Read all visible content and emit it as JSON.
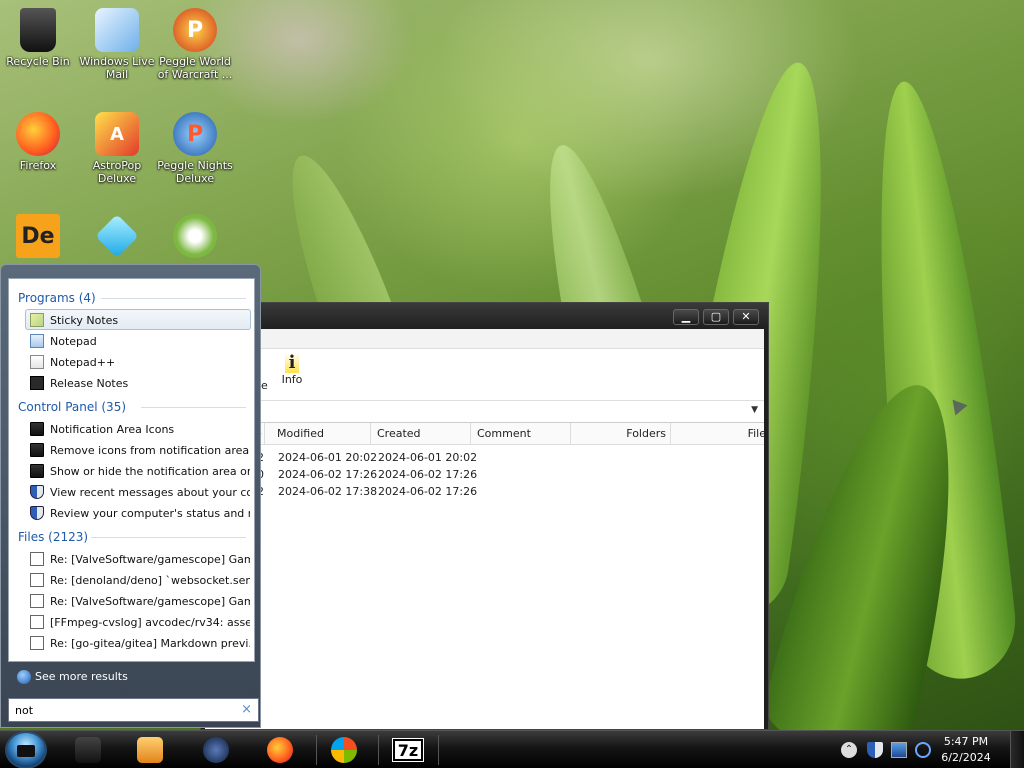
{
  "desktop": {
    "icons": [
      {
        "label": "Recycle Bin"
      },
      {
        "label": "Windows Live Mail"
      },
      {
        "label": "Peggle World of Warcraft ..."
      },
      {
        "label": "Firefox"
      },
      {
        "label": "AstroPop Deluxe"
      },
      {
        "label": "Peggle Nights Deluxe"
      },
      {
        "label": ""
      },
      {
        "label": ""
      },
      {
        "label": ""
      }
    ]
  },
  "window": {
    "toolbar_partial_label": "e",
    "info_label": "Info",
    "minimize": "▁",
    "maximize": "▢",
    "close": "✕",
    "columns": {
      "partial": "e",
      "modified": "Modified",
      "created": "Created",
      "comment": "Comment",
      "folders": "Folders",
      "files": "File"
    },
    "rows": [
      {
        "partial": "2",
        "modified": "2024-06-01 20:02",
        "created": "2024-06-01 20:02"
      },
      {
        "partial": "0",
        "modified": "2024-06-02 17:26",
        "created": "2024-06-02 17:26"
      },
      {
        "partial": "2",
        "modified": "2024-06-02 17:38",
        "created": "2024-06-02 17:26"
      }
    ]
  },
  "start_menu": {
    "programs": {
      "header": "Programs (4)",
      "items": [
        "Sticky Notes",
        "Notepad",
        "Notepad++",
        "Release Notes"
      ]
    },
    "control_panel": {
      "header": "Control Panel (35)",
      "items": [
        "Notification Area Icons",
        "Remove icons from notification area (...",
        "Show or hide the notification area on ...",
        "View recent messages about your co...",
        "Review your computer's status and re..."
      ]
    },
    "files": {
      "header": "Files (2123)",
      "items": [
        "Re: [ValveSoftware/gamescope] Gam...",
        "Re: [denoland/deno] `websocket.send...",
        "Re: [ValveSoftware/gamescope] Gam...",
        "[FFmpeg-cvslog] avcodec/rv34: asser...",
        "Re: [go-gitea/gitea] Markdown previ..."
      ]
    },
    "see_more": "See more results",
    "search_value": "not",
    "clear_glyph": "×"
  },
  "taskbar": {
    "time": "5:47 PM",
    "date": "6/2/2024",
    "seven_zip_label": "7z"
  },
  "colors": {
    "accent_blue": "#1e5aa8",
    "taskbar": "#151515"
  }
}
